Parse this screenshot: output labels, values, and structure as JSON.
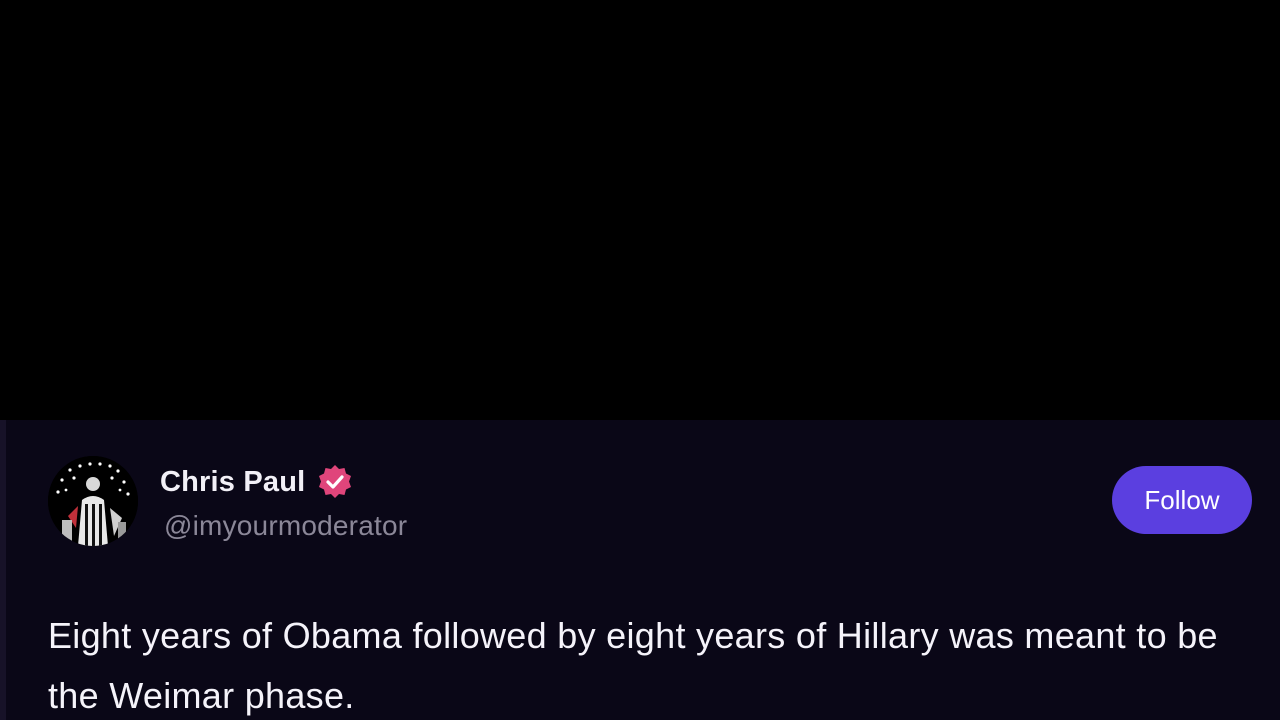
{
  "post": {
    "author": {
      "display_name": "Chris Paul",
      "handle": "@imyourmoderator",
      "verified_icon": "verified-check-icon",
      "avatar": "avatar-image"
    },
    "follow_label": "Follow",
    "text": "Eight years of Obama followed by eight years of Hillary was meant to be the Weimar phase."
  },
  "colors": {
    "background_top": "#000000",
    "card_background": "#0a0717",
    "follow_button": "#5b3fe0",
    "verified_badge": "#e0457b",
    "handle_text": "#8b8798"
  }
}
